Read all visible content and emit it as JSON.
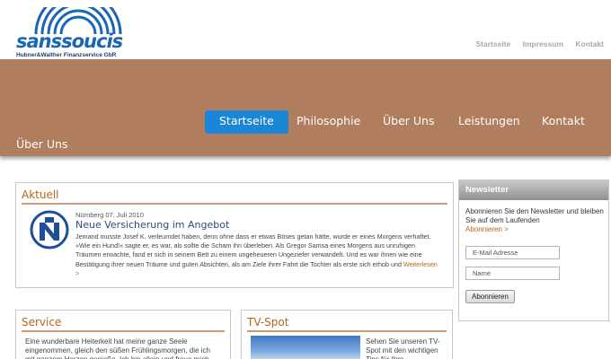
{
  "logo": {
    "word_part1": "sans",
    "word_part2": "soucis",
    "subtitle": "Hubner&Walther Finanzservice GbR",
    "icon": "arc-rainbow-logo"
  },
  "top_nav": [
    "Startseite",
    "Impressum",
    "Kontakt"
  ],
  "main_nav": {
    "items": [
      "Startseite",
      "Philosophie",
      "Über Uns",
      "Leistungen",
      "Kontakt",
      "Über Uns"
    ],
    "active": "Startseite"
  },
  "colors": {
    "band": "#b07d5e",
    "active_nav": "#1a86d6",
    "accent": "#b5651d",
    "link_blue": "#2a4c7a"
  },
  "aktuell": {
    "heading": "Aktuell",
    "icon": "nuremberg-n-icon",
    "date": "Nürnberg 07. Juli 2010",
    "title": "Neue Versicherung im Angebot",
    "text": "Jemand musste Josef K. verleumdet haben, denn ohne dass er etwas Böses getan hätte, wurde er eines Morgens verhaftet. »Wie ein Hund!« sagte er, es war, als sollte die Scham ihn überleben. Als Gregor Samsa eines Morgens aus unruhigen Träumen erwachte, fand er sich in seinem Bett zu einem ungeheueren Ungeziefer verwandelt. Und es war ihnen wie eine Bestätigung ihrer neuen Träume und guten Absichten, als am Ziele ihrer Fahrt die Tochter als erste sich erhob und",
    "more": "Weiterlesen >"
  },
  "newsletter": {
    "heading": "Newsletter",
    "text": "Abonnieren Sie den Newsletter und bleiben Sie auf dem Laufenden",
    "link": "Abonnieren >",
    "email_placeholder": "E-Mail Adresse",
    "name_placeholder": "Name",
    "button": "Abonnieren"
  },
  "service": {
    "heading": "Service",
    "text": "Eine wunderbare Heiterkeit hat meine ganze Seele eingenommen, gleich den süßen Frühlingsmorgen, die ich mit ganzem Herzen genieße. Ich bin allein und freue mich"
  },
  "tvspot": {
    "heading": "TV-Spot",
    "text": "Sehen Sie unseren TV-Spot mit den wichtigen Tips für Ihre"
  }
}
